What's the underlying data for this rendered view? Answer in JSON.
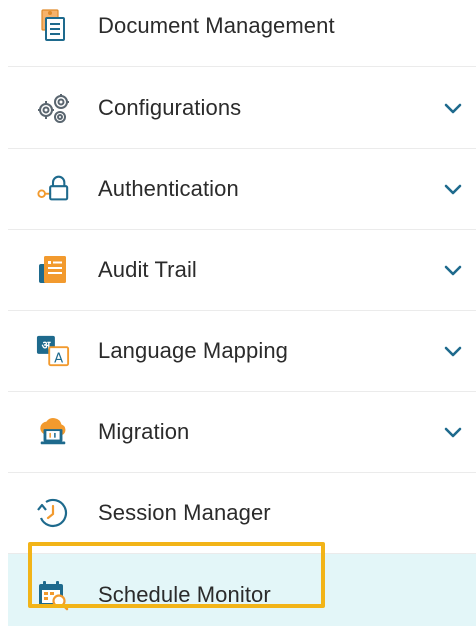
{
  "menu": {
    "items": [
      {
        "label": "Document Management",
        "icon": "document-stack-icon",
        "has_chevron": false
      },
      {
        "label": "Configurations",
        "icon": "gears-icon",
        "has_chevron": true
      },
      {
        "label": "Authentication",
        "icon": "key-lock-icon",
        "has_chevron": true
      },
      {
        "label": "Audit Trail",
        "icon": "audit-notebook-icon",
        "has_chevron": true
      },
      {
        "label": "Language Mapping",
        "icon": "language-translate-icon",
        "has_chevron": true
      },
      {
        "label": "Migration",
        "icon": "cloud-migration-icon",
        "has_chevron": true
      },
      {
        "label": "Session Manager",
        "icon": "session-history-icon",
        "has_chevron": false
      },
      {
        "label": "Schedule Monitor",
        "icon": "calendar-search-icon",
        "has_chevron": false,
        "active": true
      }
    ],
    "chevron_icon": "chevron-down-icon",
    "colors": {
      "active_background": "#e3f6f8",
      "highlight_border": "#f2b418",
      "chevron": "#1e6a8d",
      "icon_orange": "#f29a2e",
      "icon_teal": "#1e6a8d"
    }
  }
}
